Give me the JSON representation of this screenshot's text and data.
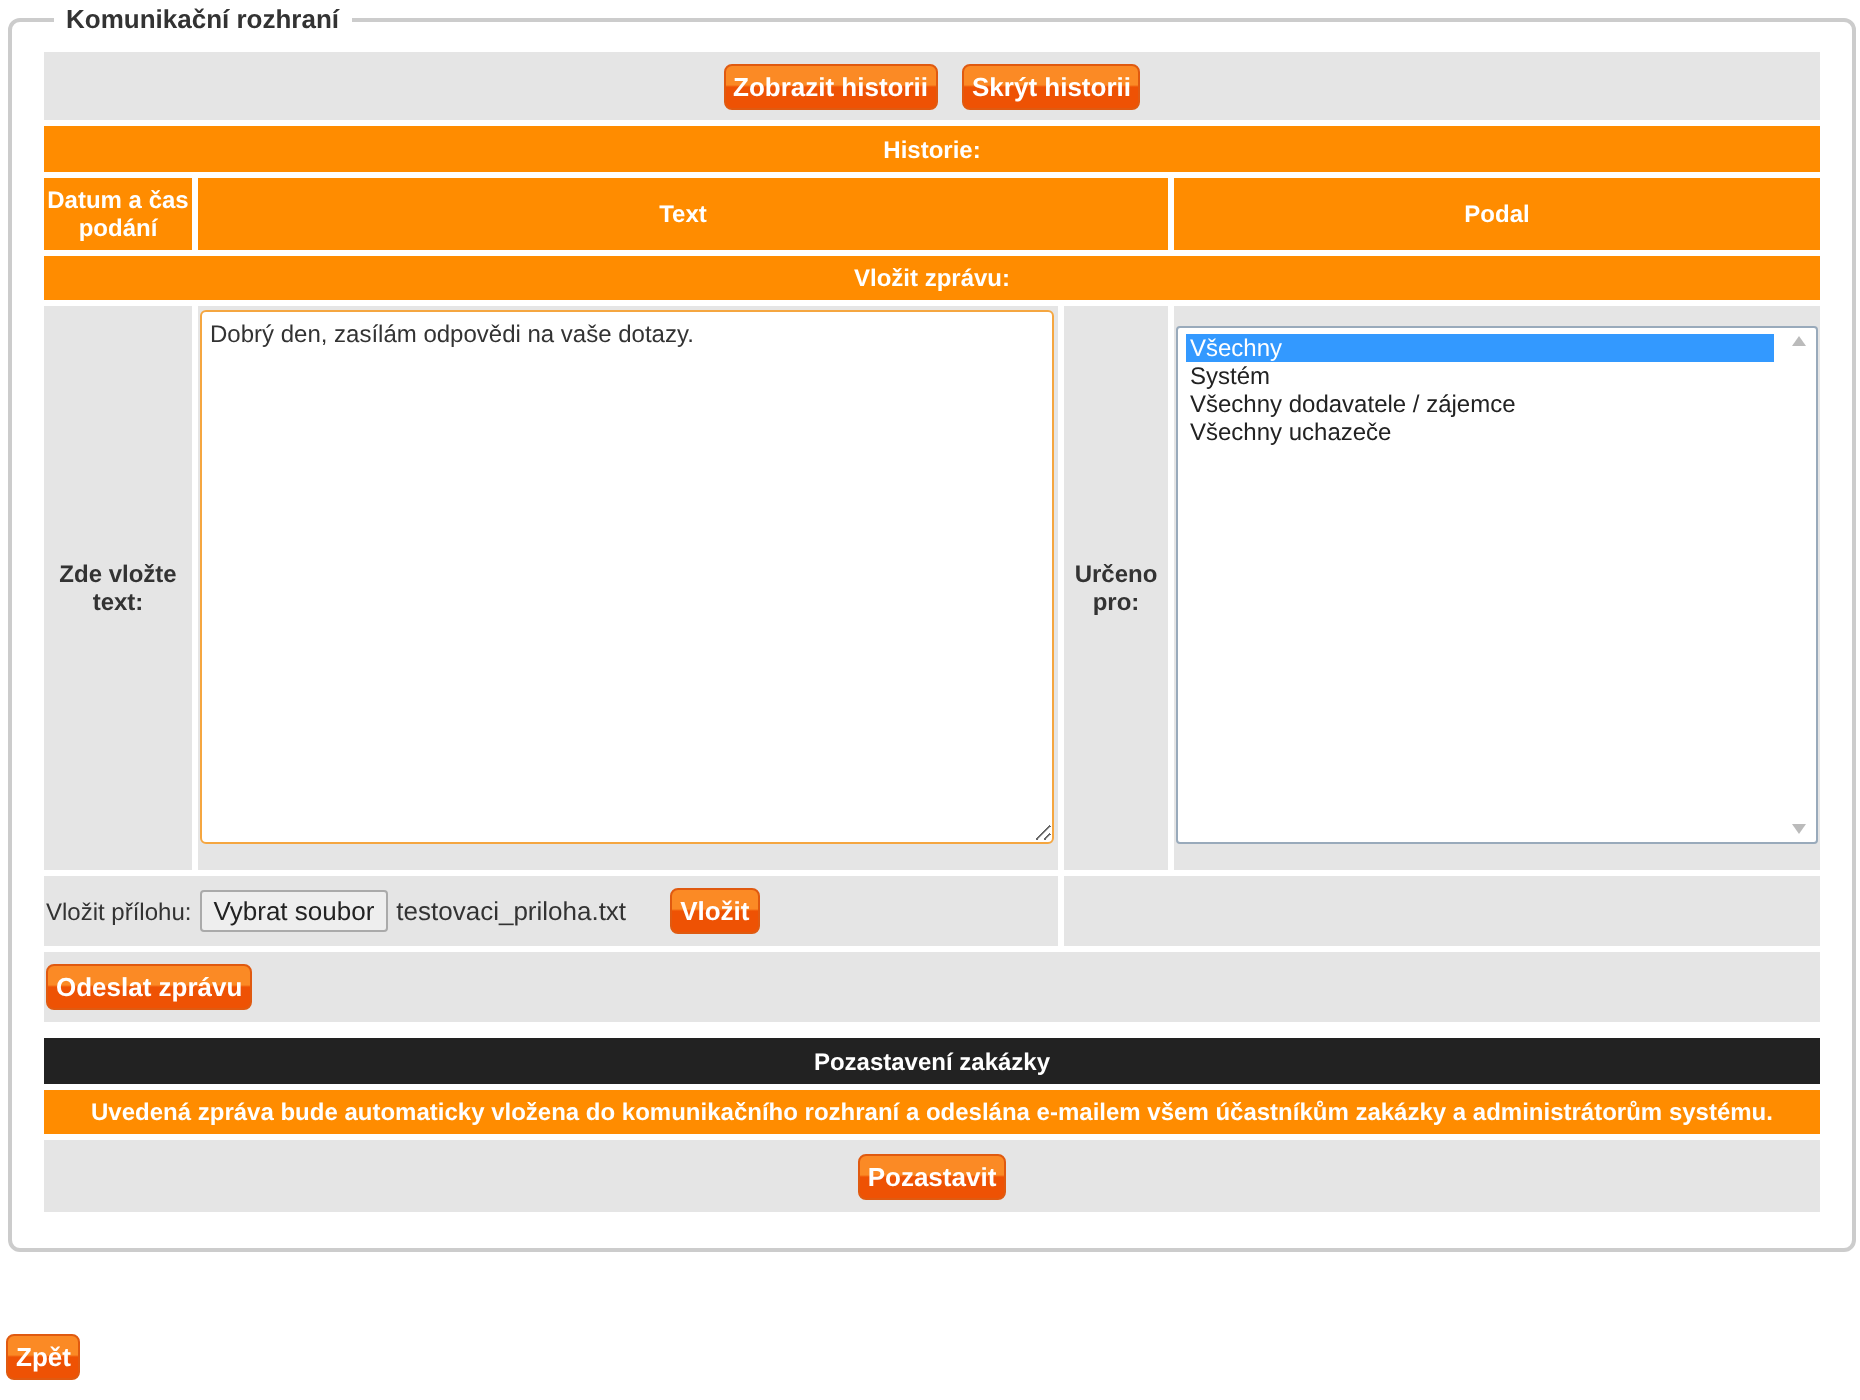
{
  "panel": {
    "title": "Komunikační rozhraní"
  },
  "history_buttons": [
    "Zobrazit historii",
    "Skrýt historii"
  ],
  "history": {
    "title": "Historie:",
    "columns": [
      "Datum a čas podání",
      "Text",
      "Podal"
    ]
  },
  "compose": {
    "title": "Vložit zprávu:",
    "text_label": "Zde vložte text:",
    "text_value": "Dobrý den, zasílám odpovědi na vaše dotazy.",
    "recipient_label": "Určeno pro:",
    "recipients": [
      {
        "label": "Všechny",
        "selected": true
      },
      {
        "label": "Systém",
        "selected": false
      },
      {
        "label": "Všechny dodavatele / zájemce",
        "selected": false
      },
      {
        "label": "Všechny uchazeče",
        "selected": false
      }
    ],
    "attachment_label": "Vložit přílohu:",
    "file_button": "Vybrat soubor",
    "file_name": "testovaci_priloha.txt",
    "attach_button": "Vložit",
    "send_button": "Odeslat zprávu"
  },
  "suspension": {
    "title": "Pozastavení zakázky",
    "notice": "Uvedená zpráva bude automaticky vložena do komunikačního rozhraní a odeslána e-mailem všem účastníkům zakázky a administrátorům systému.",
    "button": "Pozastavit"
  },
  "back_button": "Zpět"
}
